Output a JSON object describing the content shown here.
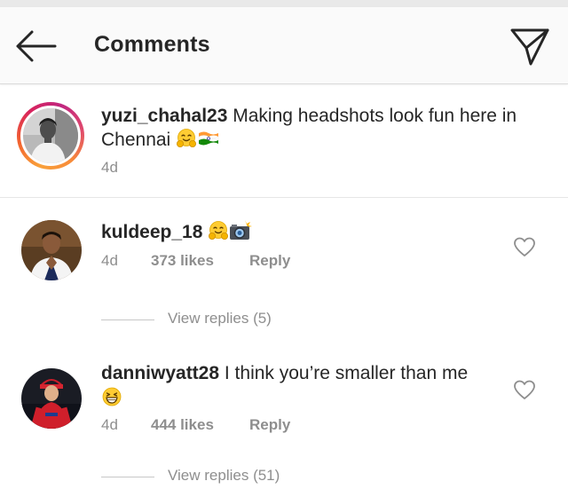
{
  "header": {
    "title": "Comments",
    "back_icon": "arrow-left-icon",
    "direct_icon": "paper-plane-icon"
  },
  "caption": {
    "username": "yuzi_chahal23",
    "text": " Making headshots look fun here in Chennai ",
    "emojis": [
      "hugging-face-emoji",
      "india-flag-emoji"
    ],
    "time": "4d"
  },
  "comments": [
    {
      "username": "kuldeep_18",
      "text": " ",
      "emojis": [
        "hugging-face-emoji",
        "camera-with-flash-emoji"
      ],
      "time": "4d",
      "likes": "373 likes",
      "reply_label": "Reply",
      "view_replies": "View replies (5)"
    },
    {
      "username": "danniwyatt28",
      "text": " I think you’re smaller than me",
      "emojis": [
        "grinning-squinting-emoji"
      ],
      "time": "4d",
      "likes": "444 likes",
      "reply_label": "Reply",
      "view_replies": "View replies (51)"
    }
  ],
  "colors": {
    "text": "#262626",
    "secondary": "#8e8e8e",
    "header_bg": "#fafafa",
    "divider": "#dbdbdb"
  }
}
